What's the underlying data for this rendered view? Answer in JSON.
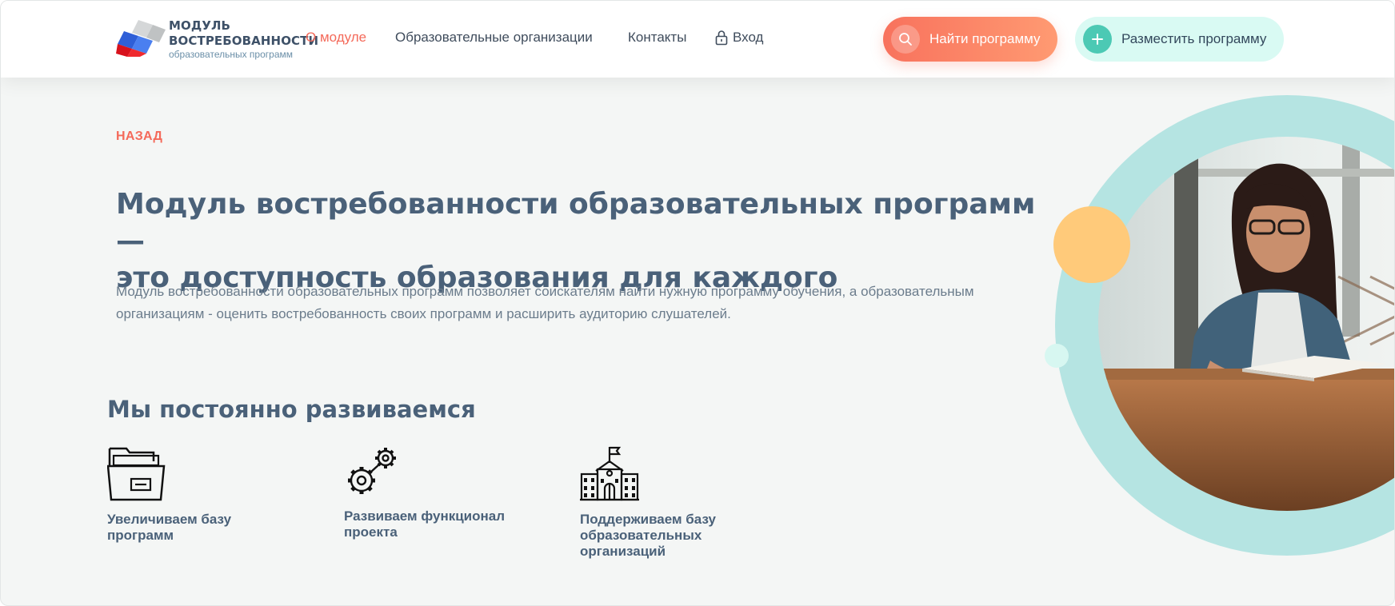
{
  "header": {
    "logo": {
      "line1": "МОДУЛЬ",
      "line2": "ВОСТРЕБОВАННОСТИ",
      "line3": "образовательных программ"
    },
    "nav": [
      {
        "label": "О модуле",
        "active": true
      },
      {
        "label": "Образовательные организации",
        "active": false
      },
      {
        "label": "Контакты",
        "active": false
      }
    ],
    "login_label": "Вход",
    "find_button": "Найти программу",
    "place_button": "Разместить программу"
  },
  "main": {
    "back_label": "НАЗАД",
    "title_line1": "Модуль востребованности образовательных программ —",
    "title_line2": "это доступность образования для каждого",
    "subtitle_line1": "Модуль востребованности образовательных программ позволяет соискателям найти нужную программу обучения, а образовательным",
    "subtitle_line2": "организациям - оценить востребованность своих программ и расширить аудиторию слушателей."
  },
  "section": {
    "title": "Мы постоянно развиваемся",
    "features": [
      {
        "icon": "folder-archive-icon",
        "label_line1": "Увеличиваем базу",
        "label_line2": "программ",
        "label_line3": ""
      },
      {
        "icon": "gears-icon",
        "label_line1": "Развиваем функционал",
        "label_line2": "проекта",
        "label_line3": ""
      },
      {
        "icon": "school-building-icon",
        "label_line1": "Поддерживаем базу",
        "label_line2": "образовательных",
        "label_line3": "организаций"
      }
    ]
  },
  "colors": {
    "accent": "#f46a5a",
    "heading": "#4a6179",
    "mint": "#b5e4e2",
    "yellow": "#ffca7a"
  }
}
